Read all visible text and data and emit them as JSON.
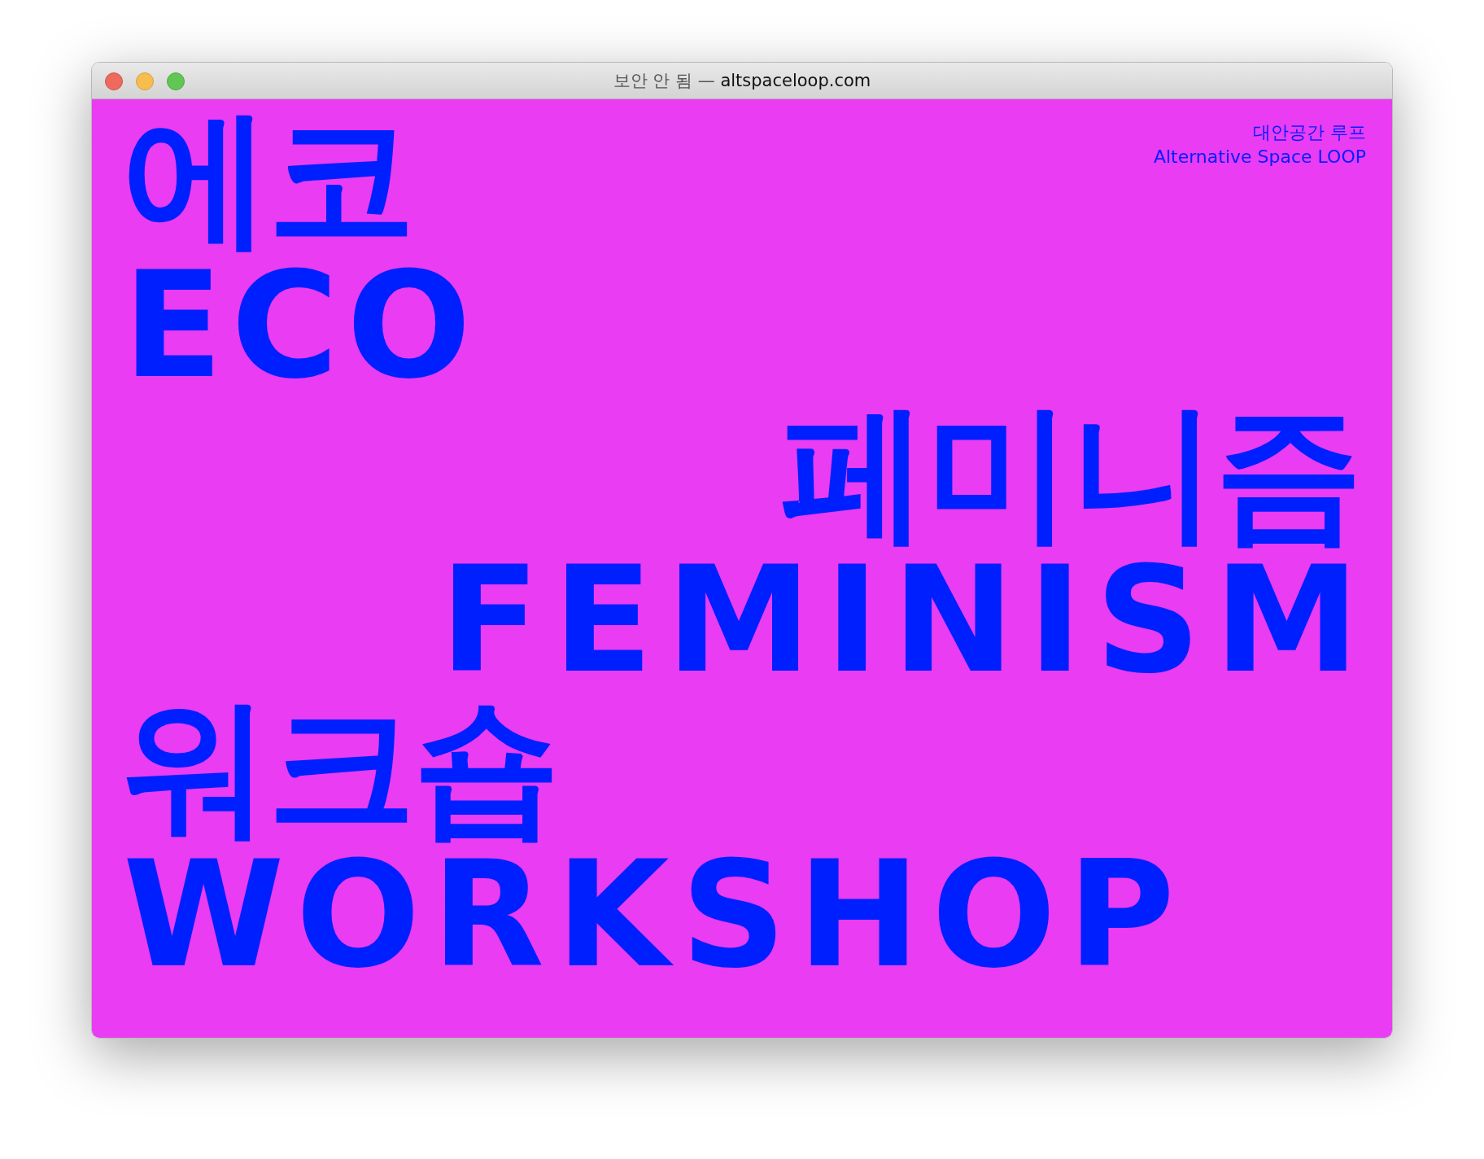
{
  "window": {
    "title_prefix": "보안 안 됨 —",
    "title_domain": "altspaceloop.com"
  },
  "site": {
    "name_ko": "대안공간 루프",
    "name_en": "Alternative Space LOOP"
  },
  "headline": {
    "lines": [
      {
        "text": "에코",
        "kind": "korean"
      },
      {
        "text": "ECO",
        "kind": "latin"
      },
      {
        "text": "페미니즘",
        "kind": "korean"
      },
      {
        "text": "FEMINISM",
        "kind": "latin"
      },
      {
        "text": "워크숍",
        "kind": "korean"
      },
      {
        "text": "WORKSHOP",
        "kind": "latin"
      }
    ]
  }
}
